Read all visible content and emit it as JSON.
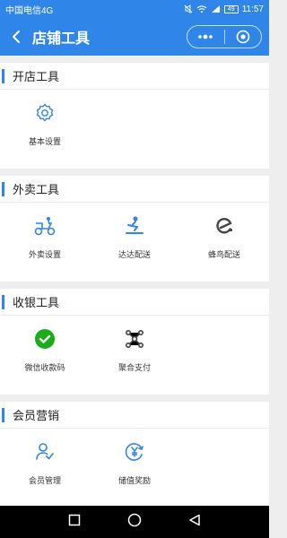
{
  "status_bar": {
    "carrier": "中国电信4G",
    "battery": "49",
    "time": "11:57"
  },
  "header": {
    "title": "店铺工具"
  },
  "sections": [
    {
      "title": "开店工具",
      "items": [
        {
          "label": "基本设置",
          "icon": "gear-icon"
        }
      ]
    },
    {
      "title": "外卖工具",
      "items": [
        {
          "label": "外卖设置",
          "icon": "delivery-scooter-icon"
        },
        {
          "label": "达达配送",
          "icon": "dada-courier-icon"
        },
        {
          "label": "蜂鸟配送",
          "icon": "hummingbird-e-icon"
        }
      ]
    },
    {
      "title": "收银工具",
      "items": [
        {
          "label": "微信收款码",
          "icon": "wechat-icon"
        },
        {
          "label": "聚合支付",
          "icon": "aggregate-network-icon"
        }
      ]
    },
    {
      "title": "会员营销",
      "items": [
        {
          "label": "会员管理",
          "icon": "member-user-icon"
        },
        {
          "label": "储值奖励",
          "icon": "stored-value-yen-icon"
        }
      ]
    }
  ],
  "colors": {
    "primary": "#2f86e8",
    "wechat": "#1aad19",
    "background": "#eeeeee"
  }
}
